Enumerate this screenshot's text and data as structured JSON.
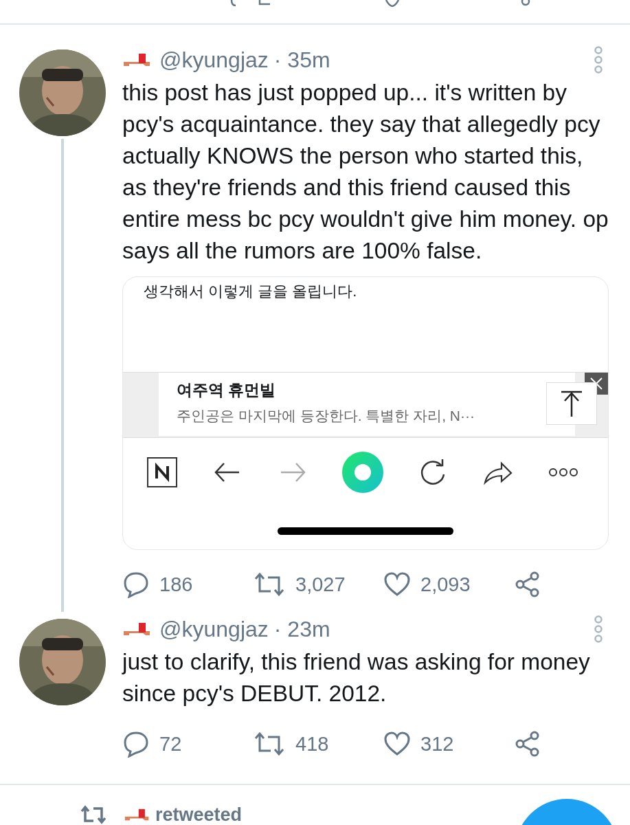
{
  "tweets": [
    {
      "handle": "@kyungjaz",
      "time": "· 35m",
      "text": "this post has just popped up... it's written by pcy's acquaintance. they say that allegedly pcy actually KNOWS the person who started this, as they're friends and this friend caused this entire mess bc pcy wouldn't give him money. op says all the rumors are 100% false.",
      "embed": {
        "text": "생각해서 이렇게 글을 올립니다.",
        "ad_title": "여주역 휴먼빌",
        "ad_text": "주인공은 마지막에 등장한다. 특별한 자리, N···"
      },
      "replies": "186",
      "retweets": "3,027",
      "likes": "2,093",
      "thread_below": true
    },
    {
      "handle": "@kyungjaz",
      "time": "· 23m",
      "text": "just to clarify, this friend was asking for money since pcy's DEBUT. 2012.",
      "replies": "72",
      "retweets": "418",
      "likes": "312",
      "thread_below": false
    }
  ],
  "next": {
    "label": "retweeted"
  }
}
